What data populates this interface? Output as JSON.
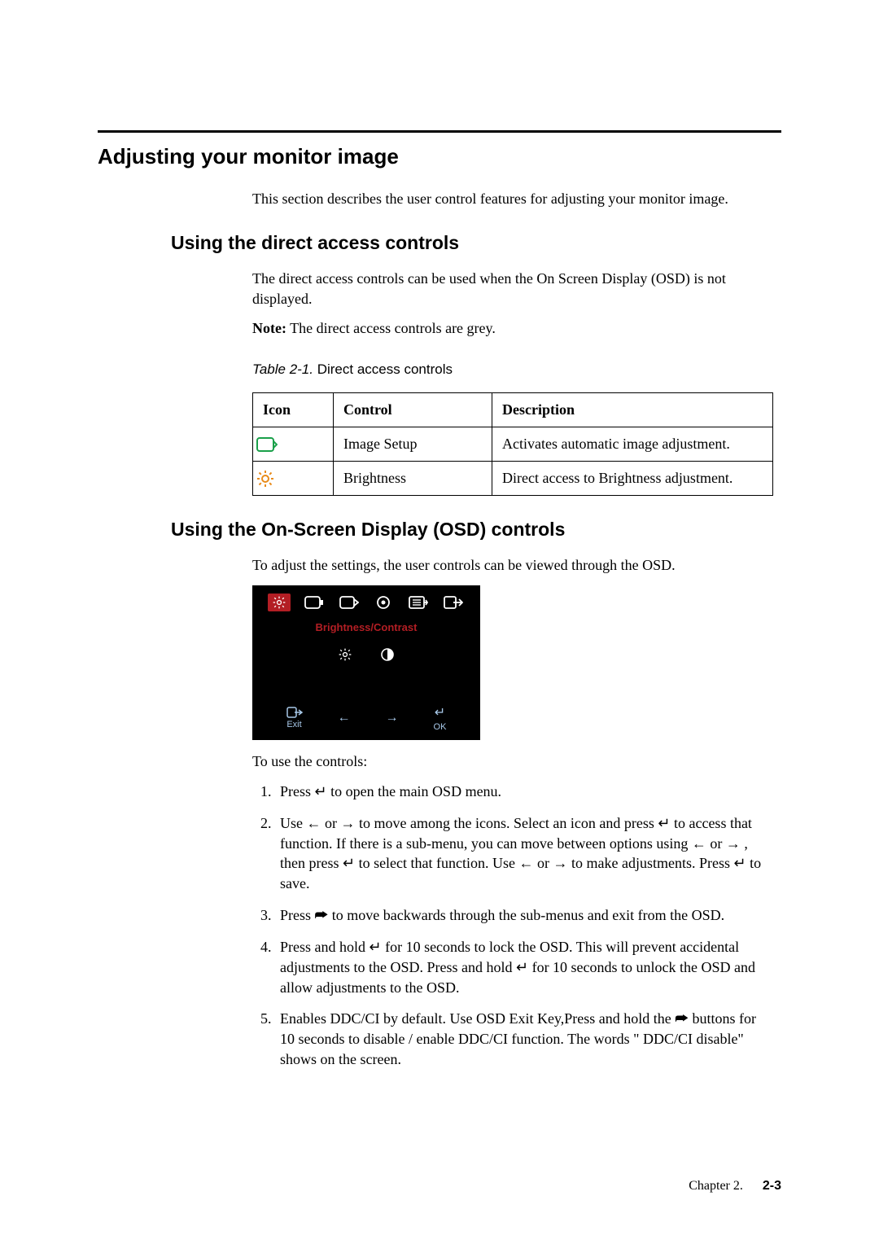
{
  "h1": "Adjusting your monitor image",
  "intro": "This section describes the user control features for adjusting your monitor image.",
  "h2a": "Using the direct access controls",
  "p1": "The direct access controls can be used when the On Screen Display (OSD) is not displayed.",
  "note_label": "Note:",
  "note_text": " The direct access controls are grey.",
  "table_caption_prefix": "Table 2-1.",
  "table_caption_text": " Direct access controls",
  "table": {
    "headers": [
      "Icon",
      "Control",
      "Description"
    ],
    "rows": [
      {
        "icon": "image-setup-icon",
        "control": "Image Setup",
        "desc": "Activates automatic image adjustment."
      },
      {
        "icon": "brightness-icon",
        "control": "Brightness",
        "desc": "Direct access to Brightness adjustment."
      }
    ]
  },
  "h2b": "Using the On-Screen Display (OSD) controls",
  "p2": "To adjust the settings, the user controls can be viewed through the OSD.",
  "osd": {
    "label": "Brightness/Contrast",
    "exit": "Exit",
    "ok": "OK"
  },
  "p3": "To use the controls:",
  "steps": [
    "Press ↵ to open the main OSD menu.",
    "Use ← or → to move among the icons. Select an icon and press ↵ to access that function. If there is a sub-menu, you can move between options using ← or → , then press ↵ to select that function. Use ← or → to make adjustments. Press ↵ to save.",
    "Press ⮫ to move backwards through the sub-menus and exit from the OSD.",
    "Press and hold ↵ for 10 seconds to lock the OSD. This will prevent accidental adjustments to the OSD. Press and hold ↵ for 10 seconds to unlock the OSD and allow adjustments to the OSD.",
    "Enables DDC/CI by default. Use OSD Exit Key,Press and hold the ⮫ buttons for 10 seconds to disable / enable DDC/CI function. The words \" DDC/CI disable\" shows on the screen."
  ],
  "footer_chapter": "Chapter 2.",
  "footer_page": "2-3"
}
